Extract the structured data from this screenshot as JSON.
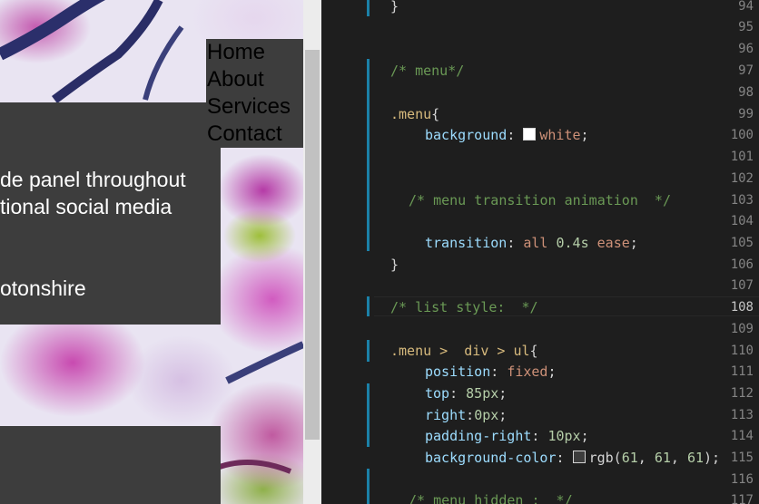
{
  "preview": {
    "nav_items": [
      "Home",
      "About",
      "Services",
      "Contact"
    ],
    "text_lines": [
      "de panel throughout",
      "tional social media",
      "otonshire"
    ]
  },
  "editor": {
    "line_numbers": [
      "94",
      "95",
      "96",
      "97",
      "98",
      "99",
      "100",
      "101",
      "102",
      "103",
      "104",
      "105",
      "106",
      "107",
      "108",
      "109",
      "110",
      "111",
      "112",
      "113",
      "114",
      "115",
      "116",
      "117"
    ],
    "active_line": "108",
    "swatch_colors": {
      "white": "#ffffff",
      "rgb61": "#3d3d3d"
    }
  },
  "code": {
    "l94": "}",
    "l97": "/* menu*/",
    "l99_sel": ".menu",
    "l99_brace": "{",
    "l100_prop": "background",
    "l100_colon": ": ",
    "l100_val": "white",
    "l100_semi": ";",
    "l103": "/* menu transition animation  */",
    "l105_prop": "transition",
    "l105_colon": ": ",
    "l105_val1": "all ",
    "l105_num": "0.4s",
    "l105_val2": " ease",
    "l105_semi": ";",
    "l106": "}",
    "l108": "/* list style:  */",
    "l110_sel": ".menu >  div > ul",
    "l110_brace": "{",
    "l111_prop": "position",
    "l111_colon": ": ",
    "l111_val": "fixed",
    "l111_semi": ";",
    "l112_prop": "top",
    "l112_colon": ": ",
    "l112_num": "85px",
    "l112_semi": ";",
    "l113_prop": "right",
    "l113_colon": ":",
    "l113_num": "0px",
    "l113_semi": ";",
    "l114_prop": "padding-right",
    "l114_colon": ": ",
    "l114_num": "10px",
    "l114_semi": ";",
    "l115_prop": "background-color",
    "l115_colon": ": ",
    "l115_fn": "rgb(",
    "l115_n1": "61",
    "l115_c1": ", ",
    "l115_n2": "61",
    "l115_c2": ", ",
    "l115_n3": "61",
    "l115_close": ");",
    "l117": "/* menu hidden :  */"
  }
}
